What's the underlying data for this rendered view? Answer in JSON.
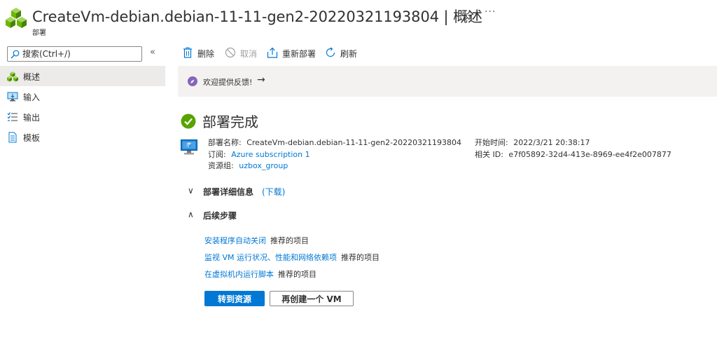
{
  "header": {
    "title": "CreateVm-debian.debian-11-11-gen2-20220321193804 | 概述",
    "subtitle": "部署",
    "resource_icon": "deployment-cubes-icon",
    "pin_icon": "pin-icon",
    "more_label": "···"
  },
  "sidebar": {
    "search_placeholder": "搜索(Ctrl+/)",
    "collapse_label": "«",
    "items": [
      {
        "label": "概述",
        "icon": "overview-cubes-icon",
        "active": true
      },
      {
        "label": "输入",
        "icon": "input-monitor-icon"
      },
      {
        "label": "输出",
        "icon": "output-list-icon"
      },
      {
        "label": "模板",
        "icon": "template-doc-icon"
      }
    ]
  },
  "toolbar": {
    "delete_label": "删除",
    "cancel_label": "取消",
    "redeploy_label": "重新部署",
    "refresh_label": "刷新"
  },
  "feedback": {
    "text": "欢迎提供反馈!",
    "arrow": "→"
  },
  "status": {
    "title": "部署完成",
    "color": "#57a300"
  },
  "details": {
    "name_label": "部署名称:",
    "name_value": "CreateVm-debian.debian-11-11-gen2-20220321193804",
    "subscription_label": "订阅:",
    "subscription_value": "Azure subscription 1",
    "rg_label": "资源组:",
    "rg_value": "uzbox_group",
    "start_label": "开始时间:",
    "start_value": "2022/3/21 20:38:17",
    "corr_label": "相关 ID:",
    "corr_value": "e7f05892-32d4-413e-8969-ee4f2e007877"
  },
  "sections": {
    "details_title": "部署详细信息",
    "download_label": "(下载)",
    "next_title": "后续步骤",
    "chevron_down": "∨",
    "chevron_up": "∧"
  },
  "steps": [
    {
      "link": "安装程序自动关闭",
      "rec": "推荐的项目"
    },
    {
      "link": "监视 VM 运行状况、性能和网络依赖项",
      "rec": "推荐的项目"
    },
    {
      "link": "在虚拟机内运行脚本",
      "rec": "推荐的项目"
    }
  ],
  "buttons": {
    "go_to_resource": "转到资源",
    "recreate_vm": "再创建一个 VM"
  },
  "colors": {
    "accent": "#0078d4",
    "success": "#57a300",
    "feedback_bg": "#f3f2f1",
    "feedback_icon": "#8764b8"
  }
}
